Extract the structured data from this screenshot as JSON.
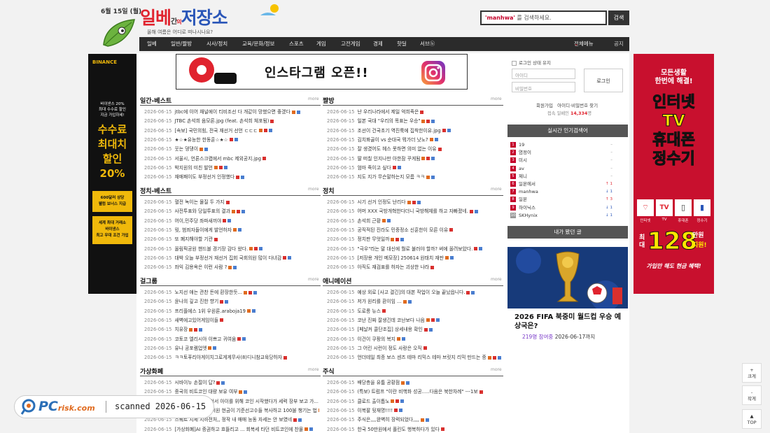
{
  "header": {
    "date": "6월 15일 (월)",
    "logo_main_red": "일베",
    "logo_small": "간",
    "logo_small2": "의",
    "logo_main_blue": "저장소",
    "logo_tagline": "올해 여름은 어디로 떠나시나요?",
    "search_keyword": "'manhwa'",
    "search_placeholder_tail": " 를 검색하세요.",
    "search_button": "검색"
  },
  "nav": {
    "items": [
      "일베",
      "일반/짤방",
      "시사/정치",
      "교육/문화/정보",
      "스포츠",
      "게임",
      "고전게임",
      "경제",
      "핫딜",
      "서브ⓑ"
    ],
    "all_menu": "전체메뉴",
    "notice": "공지"
  },
  "ad_top": {
    "text": "인스타그램 오픈!!"
  },
  "ad_left": {
    "brand": "BINANCE",
    "line1": "바이낸스 20%",
    "line2": "최대 수수료 할인",
    "line3": "지금 가입하세!",
    "big1": "수수료",
    "big2": "최대치",
    "big3": "할인",
    "big4": "20%",
    "box1a": "600달러 상당",
    "box1b": "웰컴 보너스 지급",
    "box2a": "세계 최대 거래소",
    "box2b": "바이낸스",
    "box2c": "최고 우대 조건 가입"
  },
  "ad_right": {
    "t1": "모든생활",
    "t2": "한번에 해결!",
    "t3": "인터넷",
    "t4": "TV",
    "t5": "휴대폰",
    "t6": "정수기",
    "icons": [
      "인터넷",
      "TV",
      "휴대폰",
      "정수기"
    ],
    "amount_pre": "최대",
    "amount": "128",
    "amount_unit": "만원",
    "amount_post": "지원!",
    "footer": "가입만 해도 현금 혜택!"
  },
  "sections": {
    "left": [
      {
        "title": "일간-베스트",
        "more": "more",
        "items": [
          "jtbc에 이어 채널에이 티비조선 다 개같이 망했으면 좋겠다",
          "JTBC 손석희 음모론.jpg (feat. 손석희 체포됨)",
          "[속보] 국민의힘, 전국 재선거 선언 ㄷㄷㄷ",
          "★☆★유능한 한동훈☆★☆",
          "웃는 댕댕이",
          "서울시, 언론스크랩에서 mbc 제외공지.jpg",
          "박지원의 미친 발언",
          "재매패이도 부정선거 인정했다"
        ]
      },
      {
        "title": "정치-베스트",
        "more": "more",
        "items": [
          "혈전 녹이는 물질 두 가지",
          "사전투표와 당일투표의 결과",
          "어이,민주당 좌파새끼야",
          "뭣, 범죄자들이에게 발언하자",
          "또 폐지해야할 기관",
          "올림픽공원 핸드볼 경기장 감다 왔다.",
          "대박 오늘 부정선거 재선거 집회 국회의원 많이 다녀감",
          "좌익 김용옥은 이런 사람 ?"
        ]
      },
      {
        "title": "걸그룹",
        "more": "more",
        "items": [
          "노지선 애는 관찬 돈에 환장한듯...",
          "윤나의 깊고 진한 향기",
          "프리플에스 1위 우원론.araboja19",
          "새벽에고있어게임이들",
          "치유장",
          "코토코 엘리시아 이쁘고 귀여움",
          "유나 공포렘업엣",
          "ㅋㅋ토푸리아게이치그로게게무사(8)디니참교육당하자"
        ]
      },
      {
        "title": "가상화폐",
        "more": "more",
        "items": [
          "시바이누 손절이 답?",
          "중국의 비트코인 대량 보유 여부",
          "골드 보유 흥분 있어서 아이를 위해 코인 시작했다가 세력 장부 보고 가...",
          "이재명 방식으로 3억원 현금이 기준선고수들 복사하고 100불 챙기는 법",
          "스퀘트 지세 지하전처,, 정작 내 매매 능동 자세는 안 보였네",
          "[가상화폐]AI 증권하고 흐뜰리고 ... 회복세 타던 비트코인에 찬물"
        ]
      }
    ],
    "right": [
      {
        "title": "짤방",
        "more": "more",
        "items": [
          "난 우리나라에서 제일 억희족은",
          "일본 국대 \"우리의 목표는 우승\"",
          "조선이 건국초기 역진룩에 집착한이유.jpg",
          "김치퐈골이 vs 순대국 뭐가더 낫노?",
          "잘 생겼어도 헤스 못하면 의미 없는 이유",
          "딸 떠칠 인지나만 아한잠 꾸게됨",
          "엄마 죽이고 싶다",
          "지도 지가 무슨말하는지 모름 ㅋㅋ"
        ]
      },
      {
        "title": "정치",
        "more": "more",
        "items": [
          "시기 선거 인정도 난리다",
          "어머 XXX 국방개혁한다더니 국방해체를 하고 자빠졌네.",
          "손석희 근황",
          "공직적된 진라도 민중정소 신훈한이 모른 이유",
          "정치판 무엇일까",
          "\"극우\"라는 말 대신에 뭘로 불러야 할까? 써에 올려보았다.",
          "[저장용 개인 메모장] 250614 원태치 재판",
          "아직도 재검표를 하자는 괴상한 나라"
        ]
      },
      {
        "title": "애니메이션",
        "more": "more",
        "items": [
          "예상 외로 [사고 결긴]의 대본 작업이 오늘 끝났읍니다.",
          "저가 원리를 환이임 ...",
          "도로롱 뉴스",
          "코난 진짜 잘생긴데 코난보다 나음",
          "[페날커 콜단조집] 상세내용 확인",
          "이건이 쿠팡의 복지",
          "그 어린 시런이 정도 사랑은 오직",
          "언더테일 최종 보스 센즈 테마 리믹스 테마 브릿지 리믹 만드는 중"
        ]
      },
      {
        "title": "주식",
        "more": "more",
        "items": [
          "배당층을 유튬 공황점",
          "(특보) 트럼프 \"이란 비핵화 성공.....다음은 북한차례\" ---1보",
          "클로드 출이톱노",
          "이복팔 뒷재명!!!!",
          "주식은,,,,완벽히 장력되었다,,,,",
          "한국 50만원에서 폴린도 행복하다가 있다"
        ]
      }
    ]
  },
  "sidebar": {
    "keep_login": "로그인 상태 유지",
    "id_placeholder": "아이디",
    "pw_placeholder": "비밀번호",
    "login_button": "로그인",
    "signup": "회원가입",
    "find": "아이디·비밀번호 찾기",
    "visitors_label": "접속 일베인",
    "visitors_count": "14,334",
    "visitors_unit": "명",
    "rank_title": "실시간 인기검색어",
    "ranks": [
      {
        "n": "1",
        "k": "19",
        "c": "–"
      },
      {
        "n": "2",
        "k": "염정이",
        "c": "–"
      },
      {
        "n": "3",
        "k": "미시",
        "c": "–"
      },
      {
        "n": "4",
        "k": "av",
        "c": "–"
      },
      {
        "n": "5",
        "k": "제니",
        "c": "–"
      },
      {
        "n": "6",
        "k": "일본에서",
        "c": "↑ 1"
      },
      {
        "n": "7",
        "k": "manhwa",
        "c": "↓ 1"
      },
      {
        "n": "8",
        "k": "일본",
        "c": "↑ 3"
      },
      {
        "n": "9",
        "k": "하이닉스",
        "c": "↓ 1"
      },
      {
        "n": "10",
        "k": "SKHynix",
        "c": "↓ 1"
      }
    ],
    "viewed_title": "내가 봤던 글",
    "wc_title": "2026 FIFA 북중미 월드컵 우승 예상국은?",
    "wc_count": "219명 참여중",
    "wc_date": "2026-06-17까지"
  },
  "floating": {
    "bigger": "크게",
    "smaller": "작게",
    "top": "TOP",
    "plus": "+",
    "minus": "-",
    "up": "▲"
  },
  "watermark": {
    "logo": "PC",
    "logo2": "risk.com",
    "text": "scanned 2026-06-15"
  },
  "post_date": "2026-06-15"
}
